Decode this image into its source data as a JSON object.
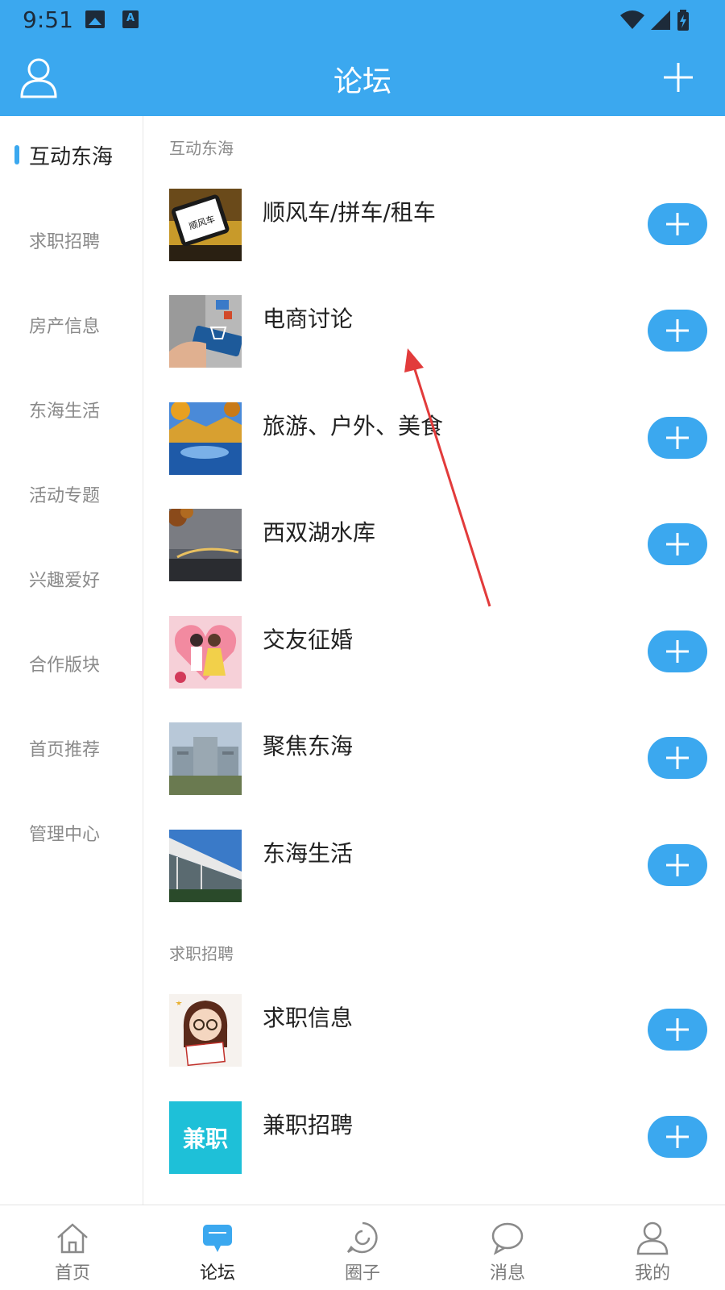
{
  "status_bar": {
    "time": "9:51",
    "icons": [
      "image-icon",
      "a-icon",
      "wifi-icon",
      "signal-icon",
      "battery-icon"
    ]
  },
  "header": {
    "title": "论坛",
    "left_icon": "user-icon",
    "right_icon": "plus-icon"
  },
  "sidebar": {
    "items": [
      {
        "label": "互动东海",
        "active": true
      },
      {
        "label": "求职招聘",
        "active": false
      },
      {
        "label": "房产信息",
        "active": false
      },
      {
        "label": "东海生活",
        "active": false
      },
      {
        "label": "活动专题",
        "active": false
      },
      {
        "label": "兴趣爱好",
        "active": false
      },
      {
        "label": "合作版块",
        "active": false
      },
      {
        "label": "首页推荐",
        "active": false
      },
      {
        "label": "管理中心",
        "active": false
      }
    ],
    "accent_color": "#3ba8ef"
  },
  "sections": [
    {
      "title": "互动东海",
      "forums": [
        {
          "name": "顺风车/拼车/租车",
          "thumb_icon": "carpool-thumbnail",
          "thumb_text": "顺风车"
        },
        {
          "name": "电商讨论",
          "thumb_icon": "ecommerce-thumbnail"
        },
        {
          "name": "旅游、户外、美食",
          "thumb_icon": "lake-autumn-thumbnail"
        },
        {
          "name": "西双湖水库",
          "thumb_icon": "reservoir-bridge-thumbnail"
        },
        {
          "name": "交友征婚",
          "thumb_icon": "couple-heart-thumbnail"
        },
        {
          "name": "聚焦东海",
          "thumb_icon": "city-building-thumbnail"
        },
        {
          "name": "东海生活",
          "thumb_icon": "stadium-thumbnail"
        }
      ]
    },
    {
      "title": "求职招聘",
      "forums": [
        {
          "name": "求职信息",
          "thumb_icon": "job-girl-thumbnail"
        },
        {
          "name": "兼职招聘",
          "thumb_icon": "parttime-thumbnail",
          "thumb_text": "兼职"
        }
      ]
    }
  ],
  "bottom_nav": [
    {
      "label": "首页",
      "icon": "home-icon",
      "active": false
    },
    {
      "label": "论坛",
      "icon": "forum-icon",
      "active": true
    },
    {
      "label": "圈子",
      "icon": "circle-icon",
      "active": false
    },
    {
      "label": "消息",
      "icon": "message-icon",
      "active": false
    },
    {
      "label": "我的",
      "icon": "profile-icon",
      "active": false
    }
  ],
  "colors": {
    "primary": "#3ba8ef",
    "annotation_arrow": "#e23b3b"
  }
}
